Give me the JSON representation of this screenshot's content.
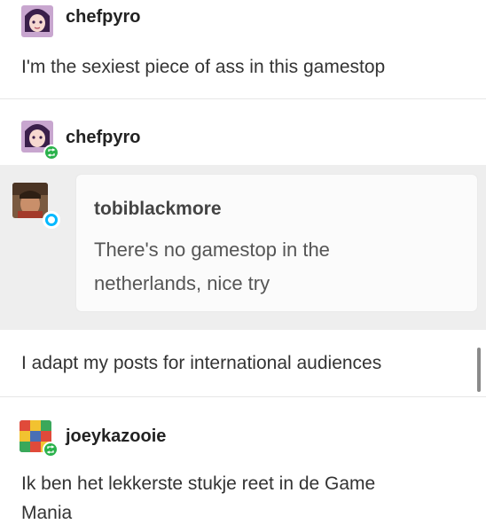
{
  "post1": {
    "username": "chefpyro",
    "text": "I'm the sexiest piece of ass in this gamestop"
  },
  "post2": {
    "username": "chefpyro",
    "ask": {
      "asker": "tobiblackmore",
      "text_line1": "There's no gamestop in the",
      "text_line2": "netherlands, nice try"
    },
    "answer": "I adapt my posts for international audiences"
  },
  "post3": {
    "username": "joeykazooie",
    "text_line1": "Ik ben het lekkerste stukje reet in de Game",
    "text_line2": "Mania"
  },
  "colors": {
    "reblog_green": "#2bb24c",
    "reply_blue": "#00b8ff",
    "ask_background": "#eeeeee",
    "divider": "#e6e6e6"
  },
  "icons": [
    "avatar-chefpyro",
    "avatar-tobiblackmore",
    "avatar-joeykazooie",
    "reblog-icon",
    "reply-icon"
  ]
}
